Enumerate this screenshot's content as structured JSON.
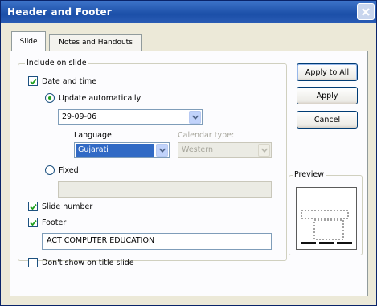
{
  "dialog": {
    "title": "Header and Footer"
  },
  "tabs": [
    {
      "label": "Slide",
      "active": true
    },
    {
      "label": "Notes and Handouts",
      "active": false
    }
  ],
  "include_group": {
    "legend": "Include on slide",
    "date_time": {
      "label": "Date and time",
      "checked": true
    },
    "update_auto": {
      "label": "Update automatically",
      "selected": true
    },
    "date_value": "29-09-06",
    "language": {
      "label": "Language:",
      "value": "Gujarati"
    },
    "calendar_type": {
      "label": "Calendar type:",
      "value": "Western",
      "disabled": true
    },
    "fixed": {
      "label": "Fixed",
      "selected": false,
      "value": ""
    },
    "slide_number": {
      "label": "Slide number",
      "checked": true
    },
    "footer": {
      "label": "Footer",
      "checked": true,
      "value": "ACT COMPUTER EDUCATION"
    }
  },
  "dont_show_title": {
    "label": "Don't show on title slide",
    "checked": false
  },
  "buttons": {
    "apply_all": "Apply to All",
    "apply": "Apply",
    "cancel": "Cancel"
  },
  "preview": {
    "legend": "Preview"
  },
  "colors": {
    "titlebar": "#1b4fa8",
    "selection": "#316ac5",
    "check": "#21a121"
  }
}
